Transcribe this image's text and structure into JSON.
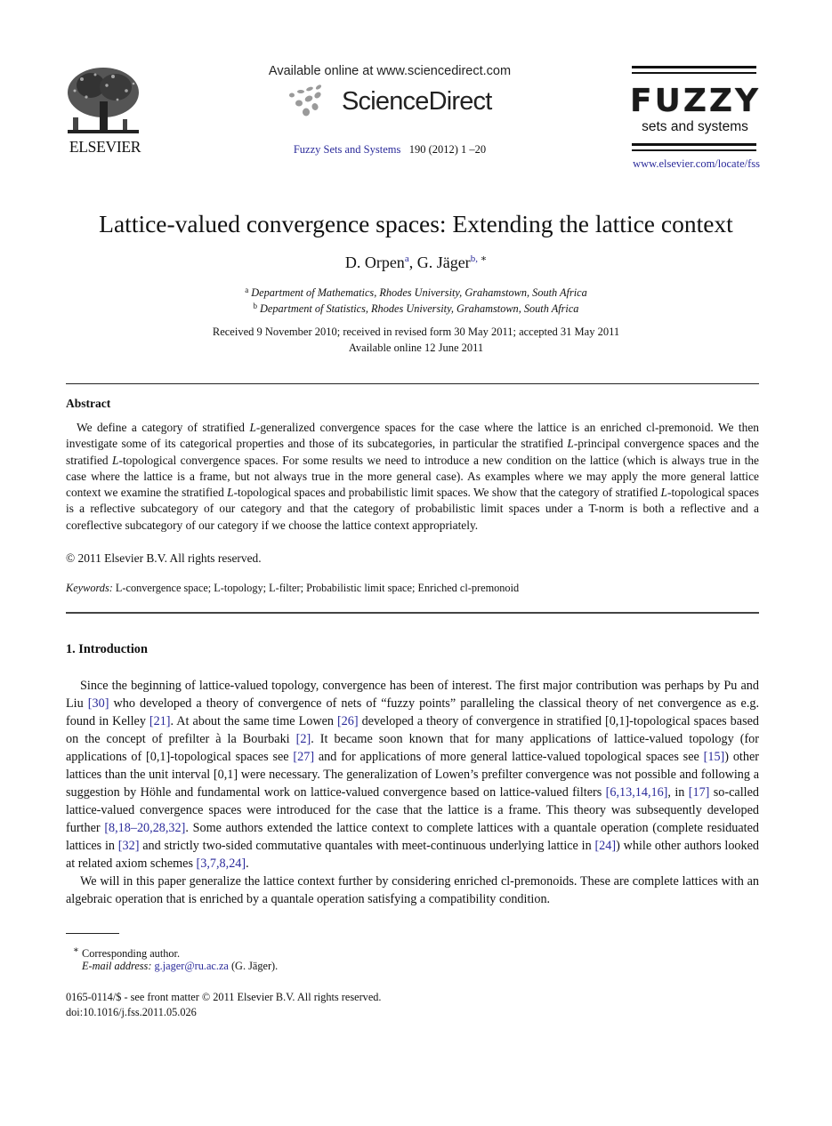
{
  "header": {
    "publisher_logo_text": "ELSEVIER",
    "available_online": "Available online at www.sciencedirect.com",
    "platform_logo_text": "ScienceDirect",
    "journal_name": "Fuzzy Sets and Systems",
    "journal_issue": "190 (2012) 1 –20",
    "journal_logo_main": "FUZZY",
    "journal_logo_sub": "sets and systems",
    "journal_url": "www.elsevier.com/locate/fss"
  },
  "article": {
    "title": "Lattice-valued convergence spaces: Extending the lattice context",
    "authors": [
      {
        "name": "D. Orpen",
        "affil_mark": "a",
        "corresponding": ""
      },
      {
        "name": "G. Jäger",
        "affil_mark": "b,",
        "corresponding": " ∗"
      }
    ],
    "author_separator": ", ",
    "affiliations": [
      {
        "mark": "a",
        "text": "Department of Mathematics, Rhodes University, Grahamstown, South Africa"
      },
      {
        "mark": "b",
        "text": "Department of Statistics, Rhodes University, Grahamstown, South Africa"
      }
    ],
    "history": "Received 9 November 2010; received in revised form 30 May 2011; accepted 31 May 2011",
    "available_online": "Available online 12 June 2011"
  },
  "abstract": {
    "heading": "Abstract",
    "segments": [
      {
        "t": "We define a category of stratified ",
        "i": false
      },
      {
        "t": "L",
        "i": true
      },
      {
        "t": "-generalized convergence spaces for the case where the lattice is an enriched cl-premonoid. We then investigate some of its categorical properties and those of its subcategories, in particular the stratified ",
        "i": false
      },
      {
        "t": "L",
        "i": true
      },
      {
        "t": "-principal convergence spaces and the stratified ",
        "i": false
      },
      {
        "t": "L",
        "i": true
      },
      {
        "t": "-topological convergence spaces. For some results we need to introduce a new condition on the lattice (which is always true in the case where the lattice is a frame, but not always true in the more general case). As examples where we may apply the more general lattice context we examine the stratified ",
        "i": false
      },
      {
        "t": "L",
        "i": true
      },
      {
        "t": "-topological spaces and probabilistic limit spaces. We show that the category of stratified ",
        "i": false
      },
      {
        "t": "L",
        "i": true
      },
      {
        "t": "-topological spaces is a reflective subcategory of our category and that the category of probabilistic limit spaces under a T-norm is both a reflective and a coreflective subcategory of our category if we choose the lattice context appropriately.",
        "i": false
      }
    ],
    "copyright": "© 2011 Elsevier B.V. All rights reserved.",
    "keywords_label": "Keywords:",
    "keywords": "L-convergence space; L-topology; L-filter; Probabilistic limit space; Enriched cl-premonoid"
  },
  "introduction": {
    "heading": "1.  Introduction",
    "paragraphs": [
      [
        {
          "t": "Since the beginning of lattice-valued topology, convergence has been of interest. The first major contribution was perhaps by Pu and Liu "
        },
        {
          "t": "[30]",
          "ref": true
        },
        {
          "t": " who developed a theory of convergence of nets of “fuzzy points” paralleling the classical theory of net convergence as e.g. found in Kelley "
        },
        {
          "t": "[21]",
          "ref": true
        },
        {
          "t": ". At about the same time Lowen "
        },
        {
          "t": "[26]",
          "ref": true
        },
        {
          "t": " developed a theory of convergence in stratified [0,1]-topological spaces based on the concept of prefilter à la Bourbaki "
        },
        {
          "t": "[2]",
          "ref": true
        },
        {
          "t": ". It became soon known that for many applications of lattice-valued topology (for applications of [0,1]-topological spaces see "
        },
        {
          "t": "[27]",
          "ref": true
        },
        {
          "t": " and for applications of more general lattice-valued topological spaces see "
        },
        {
          "t": "[15]",
          "ref": true
        },
        {
          "t": ") other lattices than the unit interval [0,1] were necessary. The generalization of Lowen’s prefilter convergence was not possible and following a suggestion by Höhle and fundamental work on lattice-valued convergence based on lattice-valued filters "
        },
        {
          "t": "[6,13,14,16]",
          "ref": true
        },
        {
          "t": ", in "
        },
        {
          "t": "[17]",
          "ref": true
        },
        {
          "t": " so-called lattice-valued convergence spaces were introduced for the case that the lattice is a frame. This theory was subsequently developed further "
        },
        {
          "t": "[8,18–20,28,32]",
          "ref": true
        },
        {
          "t": ". Some authors extended the lattice context to complete lattices with a quantale operation (complete residuated lattices in "
        },
        {
          "t": "[32]",
          "ref": true
        },
        {
          "t": " and strictly two-sided commutative quantales with meet-continuous underlying lattice in "
        },
        {
          "t": "[24]",
          "ref": true
        },
        {
          "t": ") while other authors looked at related axiom schemes "
        },
        {
          "t": "[3,7,8,24]",
          "ref": true
        },
        {
          "t": "."
        }
      ],
      [
        {
          "t": "We will in this paper generalize the lattice context further by considering enriched cl-premonoids. These are complete lattices with an algebraic operation that is enriched by a quantale operation satisfying a compatibility condition."
        }
      ]
    ]
  },
  "footnotes": {
    "corresponding_mark": "∗",
    "corresponding_text": " Corresponding author.",
    "email_label": "E-mail address:",
    "email": "g.jager@ru.ac.za",
    "email_owner": " (G. Jäger).",
    "front_matter": "0165-0114/$ - see front matter © 2011 Elsevier B.V. All rights reserved.",
    "doi": "doi:10.1016/j.fss.2011.05.026"
  },
  "colors": {
    "link": "#2a2a9a",
    "text": "#111111"
  }
}
